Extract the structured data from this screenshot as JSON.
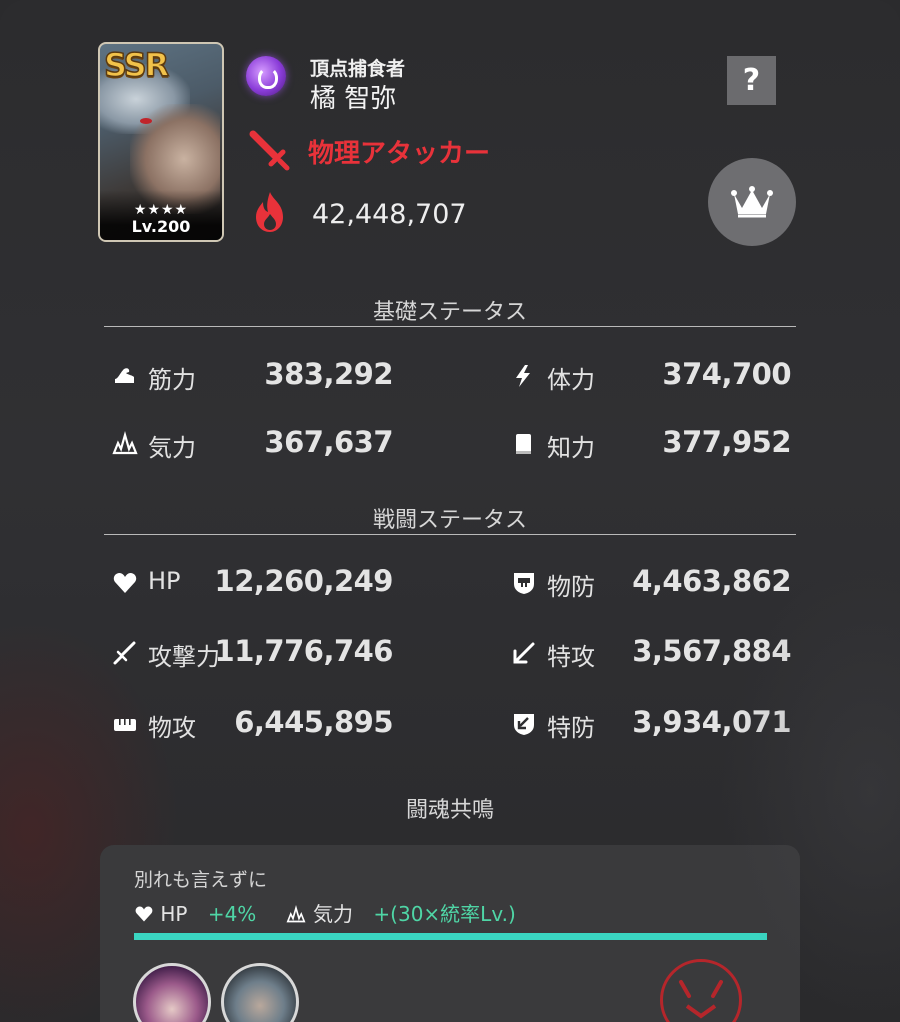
{
  "card": {
    "rarity": "SSR",
    "stars": "★★★★",
    "level": "Lv.200"
  },
  "character": {
    "title": "頂点捕食者",
    "name": "橘 智弥",
    "role": "物理アタッカー",
    "combat_power": "42,448,707"
  },
  "buttons": {
    "help": "?"
  },
  "basic_status": {
    "title": "基礎ステータス",
    "stats": [
      {
        "label": "筋力",
        "value": "383,292",
        "icon": "strength-icon"
      },
      {
        "label": "体力",
        "value": "374,700",
        "icon": "stamina-bolt-icon"
      },
      {
        "label": "気力",
        "value": "367,637",
        "icon": "spirit-flame-icon"
      },
      {
        "label": "知力",
        "value": "377,952",
        "icon": "book-icon"
      }
    ]
  },
  "battle_status": {
    "title": "戦闘ステータス",
    "stats": [
      {
        "label": "HP",
        "value": "12,260,249",
        "icon": "heart-icon"
      },
      {
        "label": "物防",
        "value": "4,463,862",
        "icon": "physical-defense-shield-icon"
      },
      {
        "label": "攻撃力",
        "value": "11,776,746",
        "icon": "attack-sword-icon"
      },
      {
        "label": "特攻",
        "value": "3,567,884",
        "icon": "special-attack-arrow-icon"
      },
      {
        "label": "物攻",
        "value": "6,445,895",
        "icon": "physical-attack-fist-icon"
      },
      {
        "label": "特防",
        "value": "3,934,071",
        "icon": "special-defense-shield-icon"
      }
    ]
  },
  "resonance": {
    "title": "闘魂共鳴",
    "name": "別れも言えずに",
    "effect1_label": "HP",
    "effect1_value": "+4%",
    "effect2_label": "気力",
    "effect2_value": "+(30×統率Lv.)",
    "progress": 1.0
  },
  "colors": {
    "accent_red": "#e8323a",
    "accent_teal": "#3ad6c2",
    "attribute_purple": "#8a3cd8"
  }
}
